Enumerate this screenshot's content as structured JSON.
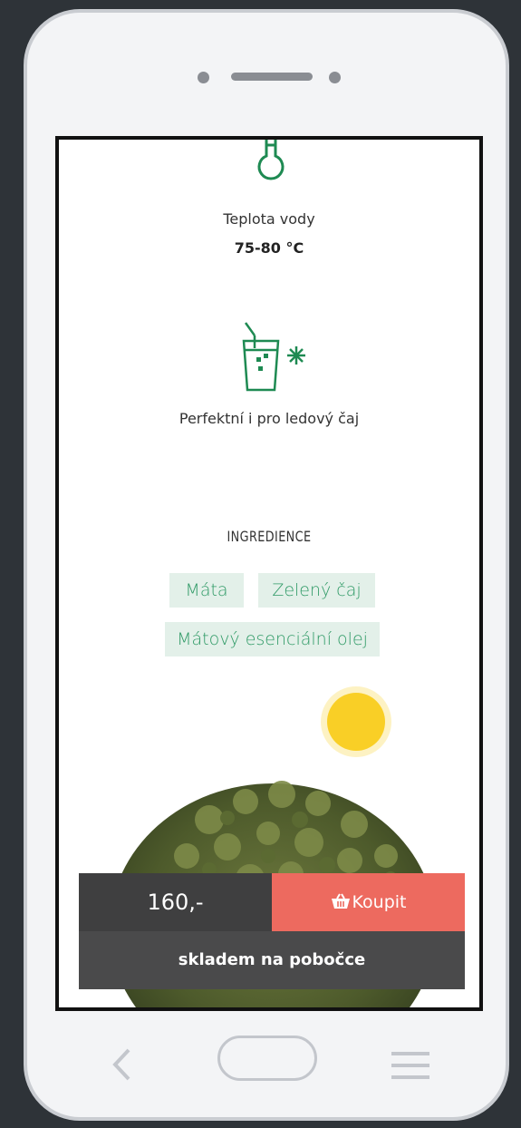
{
  "brewing": {
    "temp_label": "Teplota vody",
    "temp_value": "75-80 °C",
    "iced_label": "Perfektní i pro ledový čaj"
  },
  "ingredients": {
    "title": "INGREDIENCE",
    "items": [
      "Máta",
      "Zelený čaj",
      "Mátový esenciální olej"
    ]
  },
  "purchase": {
    "price": "160,-",
    "buy_label": "Koupit",
    "stock_label": "skladem na pobočce"
  },
  "icons": {
    "thermometer": "thermometer-icon",
    "iced_drink": "iced-drink-icon",
    "basket": "basket-icon",
    "back": "back-icon",
    "home": "home-icon",
    "menu": "menu-icon"
  },
  "colors": {
    "accent_green": "#1e8a52",
    "chip_bg": "#e3f0e9",
    "buy_button": "#ed6a5f",
    "price_bg": "#3f3f40",
    "sun": "#f9cf26"
  }
}
